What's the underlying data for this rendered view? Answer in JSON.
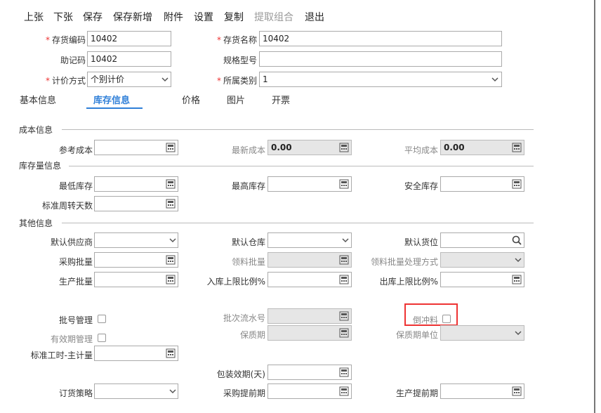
{
  "toolbar": {
    "prev": "上张",
    "next": "下张",
    "save": "保存",
    "save_new": "保存新增",
    "attach": "附件",
    "settings": "设置",
    "copy": "复制",
    "extract": "提取组合",
    "exit": "退出"
  },
  "header": {
    "code_label": "存货编码",
    "code_value": "10402",
    "name_label": "存货名称",
    "name_value": "10402",
    "mnemonic_label": "助记码",
    "mnemonic_value": "10402",
    "spec_label": "规格型号",
    "spec_value": "",
    "pricing_label": "计价方式",
    "pricing_value": "个别计价",
    "category_label": "所属类别",
    "category_value": "1",
    "required_mark": "*"
  },
  "tabs": [
    "基本信息",
    "库存信息",
    "价格",
    "图片",
    "开票"
  ],
  "sections": {
    "cost": "成本信息",
    "stock_qty": "库存量信息",
    "other": "其他信息"
  },
  "cost": {
    "ref_label": "参考成本",
    "ref_value": "",
    "latest_label": "最新成本",
    "latest_value": "0.00",
    "avg_label": "平均成本",
    "avg_value": "0.00"
  },
  "stock": {
    "min_label": "最低库存",
    "max_label": "最高库存",
    "safe_label": "安全库存",
    "turnover_label": "标准周转天数"
  },
  "other": {
    "supplier_label": "默认供应商",
    "warehouse_label": "默认仓库",
    "location_label": "默认货位",
    "purchase_batch_label": "采购批量",
    "pick_batch_label": "领料批量",
    "pick_method_label": "领料批量处理方式",
    "prod_batch_label": "生产批量",
    "in_ratio_label": "入库上限比例%",
    "out_ratio_label": "出库上限比例%",
    "batch_mgmt_label": "批号管理",
    "batch_serial_label": "批次流水号",
    "backflush_label": "倒冲料",
    "expiry_mgmt_label": "有效期管理",
    "shelf_life_label": "保质期",
    "shelf_unit_label": "保质期单位",
    "std_hours_label": "标准工时-主计量",
    "pack_expiry_label": "包装效期(天)",
    "order_policy_label": "订货策略",
    "purchase_lead_label": "采购提前期",
    "prod_lead_label": "生产提前期"
  }
}
